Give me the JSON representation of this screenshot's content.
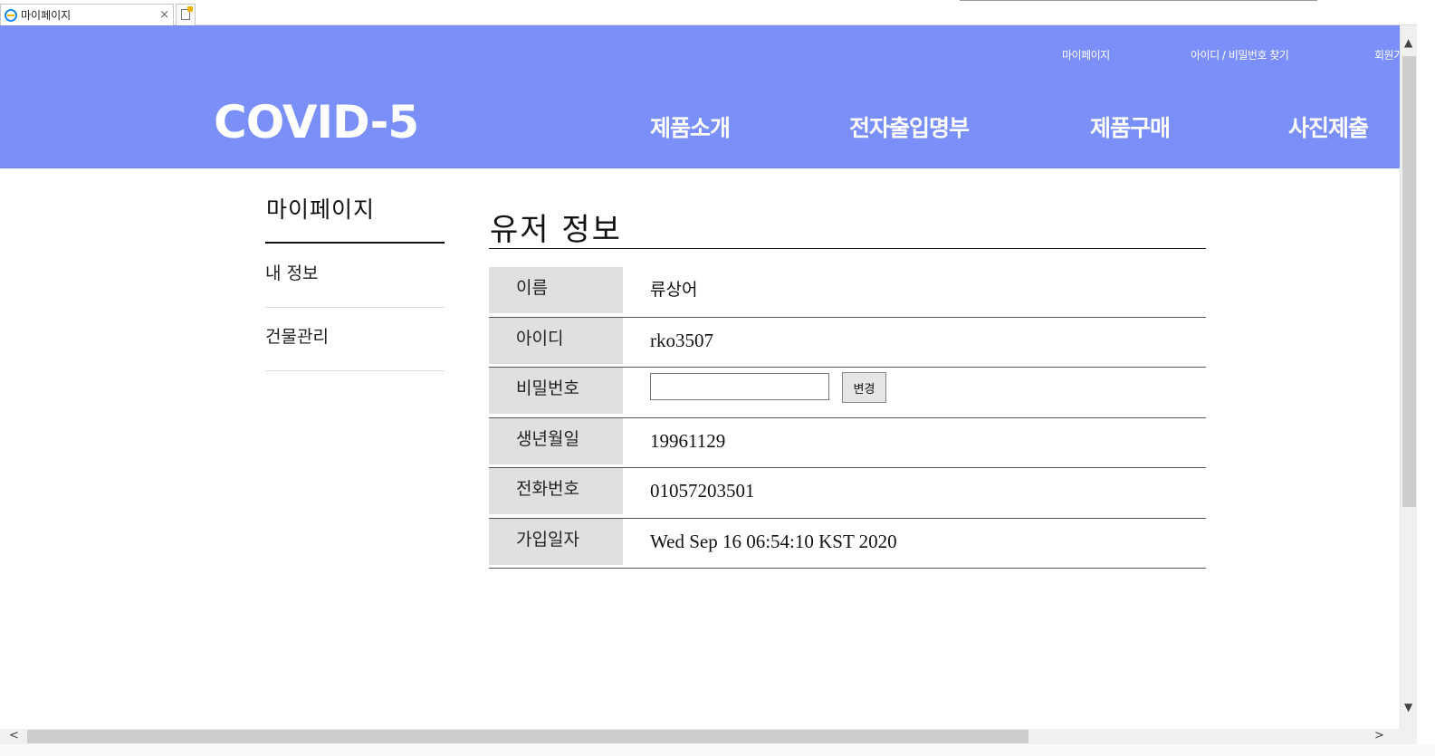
{
  "browser": {
    "tab_title": "마이페이지",
    "tab_close": "×"
  },
  "header": {
    "util_links": [
      "마이페이지",
      "아이디 / 비밀번호 찾기",
      "회원가"
    ],
    "logo": "COVID-5",
    "nav": [
      "제품소개",
      "전자출입명부",
      "제품구매",
      "사진제출"
    ],
    "bg_color": "#7b8ff9"
  },
  "sidebar": {
    "title": "마이페이지",
    "items": [
      "내 정보",
      "건물관리"
    ]
  },
  "main": {
    "title": "유저 정보",
    "rows": [
      {
        "label": "이름",
        "value": "류상어"
      },
      {
        "label": "아이디",
        "value": "rko3507"
      },
      {
        "label": "비밀번호",
        "value": ""
      },
      {
        "label": "생년월일",
        "value": "19961129"
      },
      {
        "label": "전화번호",
        "value": "01057203501"
      },
      {
        "label": "가입일자",
        "value": "Wed Sep 16 06:54:10 KST 2020"
      }
    ],
    "password_input_value": "",
    "change_button": "변경"
  },
  "icons": {
    "browser_tab_icon": "ie-icon",
    "new_tab_icon": "new-tab-icon",
    "scroll_up": "▲",
    "scroll_down": "▼",
    "scroll_left": "<",
    "scroll_right": ">"
  }
}
